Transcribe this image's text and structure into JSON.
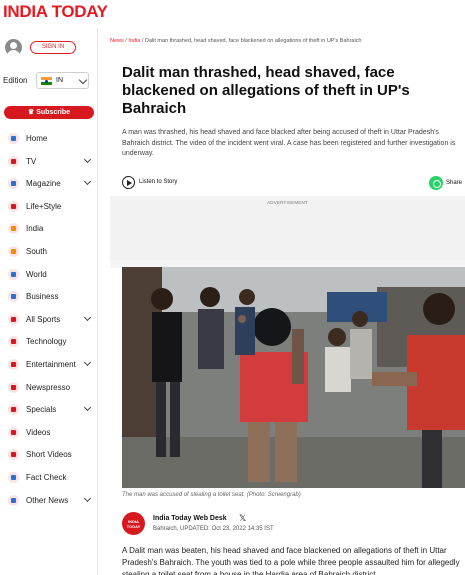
{
  "header": {
    "logo_text": "INDIA TODAY",
    "brand_color": "#e51b23"
  },
  "sidebar": {
    "signin_label": "SIGN IN",
    "edition_label": "Edition",
    "edition_value": "IN",
    "subscribe_label": "Subscribe",
    "items": [
      {
        "label": "Home",
        "icon": "home-icon",
        "has_chevron": false
      },
      {
        "label": "TV",
        "icon": "tv-icon",
        "has_chevron": true
      },
      {
        "label": "Magazine",
        "icon": "magazine-icon",
        "has_chevron": true
      },
      {
        "label": "Life+Style",
        "icon": "cocktail-icon",
        "has_chevron": false
      },
      {
        "label": "India",
        "icon": "india-gate-icon",
        "has_chevron": false
      },
      {
        "label": "South",
        "icon": "temple-icon",
        "has_chevron": false
      },
      {
        "label": "World",
        "icon": "globe-icon",
        "has_chevron": false
      },
      {
        "label": "Business",
        "icon": "bar-chart-icon",
        "has_chevron": false
      },
      {
        "label": "All Sports",
        "icon": "sports-icon",
        "has_chevron": true
      },
      {
        "label": "Technology",
        "icon": "technology-icon",
        "has_chevron": false
      },
      {
        "label": "Entertainment",
        "icon": "entertainment-icon",
        "has_chevron": true
      },
      {
        "label": "Newspresso",
        "icon": "coffee-icon",
        "has_chevron": false
      },
      {
        "label": "Specials",
        "icon": "specials-icon",
        "has_chevron": true
      },
      {
        "label": "Videos",
        "icon": "video-icon",
        "has_chevron": false
      },
      {
        "label": "Short Videos",
        "icon": "short-video-icon",
        "has_chevron": false
      },
      {
        "label": "Fact Check",
        "icon": "fact-check-icon",
        "has_chevron": false
      },
      {
        "label": "Other News",
        "icon": "other-news-icon",
        "has_chevron": true
      }
    ]
  },
  "breadcrumb": {
    "home": "News",
    "sep": "/",
    "section": "India",
    "current": "Dalit man thrashed, head shaved, face blackened on allegations of theft in UP's Bahraich"
  },
  "article": {
    "headline": "Dalit man thrashed, head shaved, face blackened on allegations of theft in UP's Bahraich",
    "summary": "A man was thrashed, his head shaved and face blacked after being accused of theft in Uttar Pradesh's Bahraich district. The video of the incident went viral. A case has been registered and further investigation is underway.",
    "listen_label": "Listen to Story",
    "share_label": "Share",
    "ad_label": "ADVERTISEMENT",
    "caption": "The man was accused of stealing a toilet seat. (Photo: Screengrab)",
    "author_logo_text": "INDIA TODAY",
    "author_name": "India Today Web Desk",
    "author_meta": "Bahraich, UPDATED: Oct 23, 2022 14:35 IST",
    "body": "A Dalit man was beaten, his head shaved and face blackened on allegations of theft in Uttar Pradesh's Bahraich. The youth was tied to a pole while three people assaulted him for allegedly stealing a toilet seat from a house in the Hardia area of Bahraich district."
  }
}
